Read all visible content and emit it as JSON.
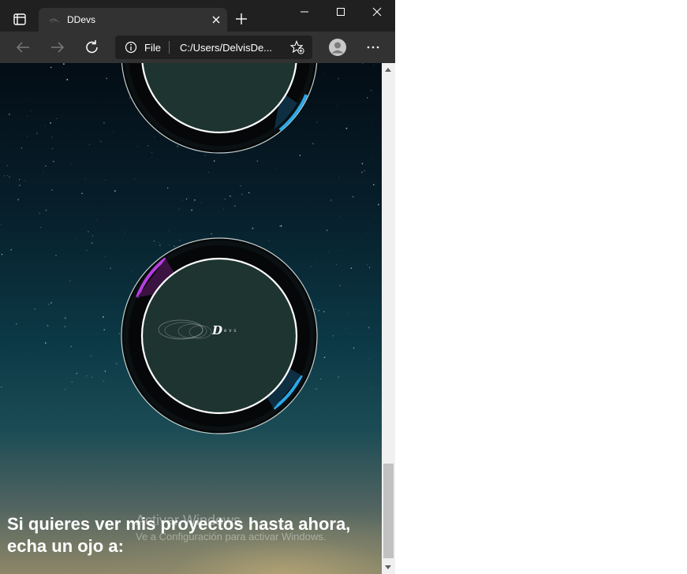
{
  "browser": {
    "tab": {
      "title": "DDevs"
    },
    "address": {
      "scheme": "File",
      "url": "C:/Users/DelvisDe..."
    },
    "icons": [
      "tab-actions-icon",
      "close-icon",
      "plus-icon",
      "minimize-icon",
      "maximize-icon",
      "window-close-icon",
      "back-icon",
      "forward-icon",
      "refresh-icon",
      "info-icon",
      "favorites-add-icon",
      "profile-icon",
      "more-icon"
    ]
  },
  "page": {
    "brand": {
      "letter": "D",
      "suffix": "evs"
    },
    "intro_text": "Si quieres ver mis proyectos hasta ahora, echa un ojo a:",
    "colors": {
      "ring_accent_blue": "#2aa8e8",
      "ring_accent_purple": "#b63ee0",
      "ring_inner": "#1e3430",
      "ring_outer": "#050708"
    }
  },
  "os_watermark": {
    "title": "Activar Windows",
    "subtitle": "Ve a Configuración para activar Windows."
  }
}
